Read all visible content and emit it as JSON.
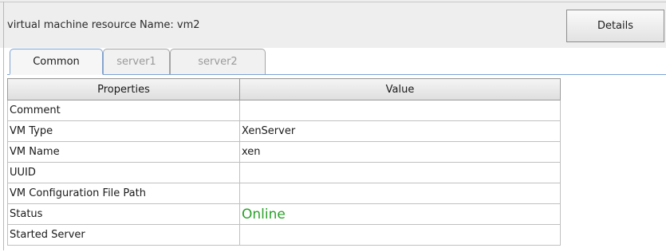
{
  "header": {
    "title": "virtual machine resource Name: vm2",
    "details_label": "Details"
  },
  "tabs": [
    {
      "label": "Common",
      "active": true
    },
    {
      "label": "server1",
      "active": false
    },
    {
      "label": "server2",
      "active": false
    }
  ],
  "table": {
    "columns": [
      "Properties",
      "Value"
    ],
    "rows": [
      {
        "property": "Comment",
        "value": ""
      },
      {
        "property": "VM Type",
        "value": "XenServer"
      },
      {
        "property": "VM Name",
        "value": "xen"
      },
      {
        "property": "UUID",
        "value": ""
      },
      {
        "property": "VM Configuration File Path",
        "value": ""
      },
      {
        "property": "Status",
        "value": "Online"
      },
      {
        "property": "Started Server",
        "value": ""
      }
    ]
  },
  "colors": {
    "status_online": "#2aa02a",
    "tab_accent": "#7da2d6"
  }
}
